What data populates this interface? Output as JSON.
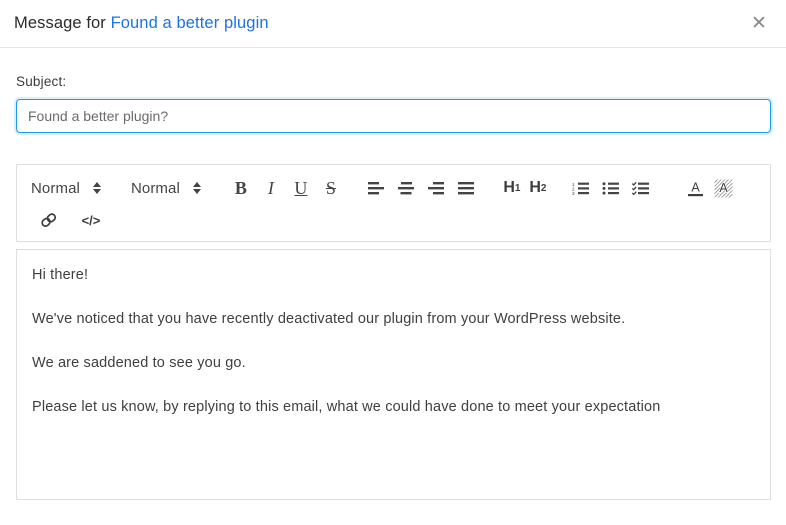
{
  "header": {
    "title_prefix": "Message for ",
    "title_link": "Found a better plugin",
    "close_label": "✕"
  },
  "subject": {
    "label": "Subject:",
    "value": "Found a better plugin?",
    "placeholder": "Found a better plugin?"
  },
  "toolbar": {
    "font_select": {
      "value": "Normal",
      "name": "font-family-select"
    },
    "size_select": {
      "value": "Normal",
      "name": "font-size-select"
    },
    "buttons": {
      "bold": "B",
      "italic": "I",
      "underline": "U",
      "strike": "S",
      "align_left": "align-left-icon",
      "align_center": "align-center-icon",
      "align_right": "align-right-icon",
      "align_justify": "align-justify-icon",
      "h1": "H",
      "h1_sub": "1",
      "h2": "H",
      "h2_sub": "2",
      "ordered_list": "ordered-list-icon",
      "bullet_list": "bullet-list-icon",
      "check_list": "check-list-icon",
      "text_color": "A",
      "background_color": "A",
      "link": "link-icon",
      "code": "</>"
    }
  },
  "editor": {
    "paragraphs": [
      "Hi there!",
      "We've noticed that you have recently deactivated our plugin from your WordPress website.",
      "We are saddened to see you go.",
      "Please let us know, by replying to this email, what we could have done to meet your expectation"
    ]
  },
  "colors": {
    "link_blue": "#1a73e8",
    "focus_blue": "#1e9bf0",
    "border_gray": "#dfdfdf",
    "text_dark": "#3f3f3f"
  }
}
